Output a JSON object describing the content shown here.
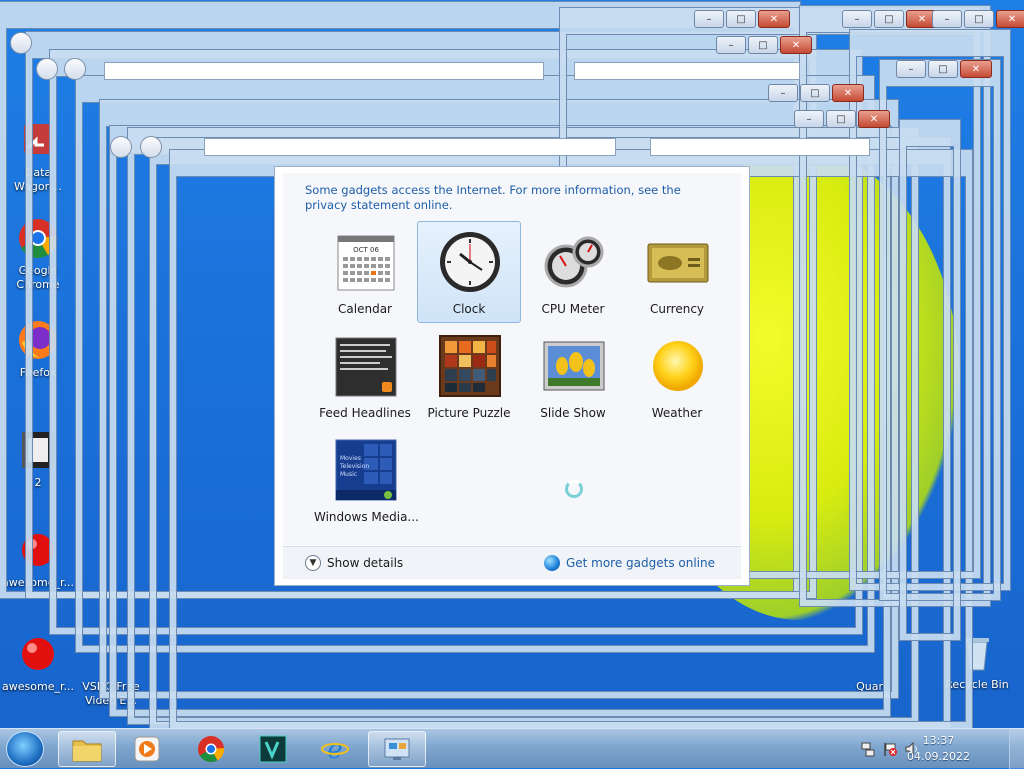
{
  "gallery": {
    "privacy_notice": "Some gadgets access the Internet.  For more information, see the privacy statement online.",
    "gadgets": [
      {
        "label": "Calendar",
        "icon": "calendar-icon",
        "month": "OCT 06"
      },
      {
        "label": "Clock",
        "icon": "clock-icon",
        "selected": true
      },
      {
        "label": "CPU Meter",
        "icon": "cpu-meter-icon"
      },
      {
        "label": "Currency",
        "icon": "currency-icon"
      },
      {
        "label": "Feed Headlines",
        "icon": "feed-headlines-icon"
      },
      {
        "label": "Picture Puzzle",
        "icon": "picture-puzzle-icon"
      },
      {
        "label": "Slide Show",
        "icon": "slide-show-icon"
      },
      {
        "label": "Weather",
        "icon": "weather-icon"
      },
      {
        "label": "Windows Media...",
        "icon": "windows-media-center-icon",
        "thumb_lines": [
          "Movies",
          "Television",
          "Music"
        ]
      }
    ],
    "show_details": "Show details",
    "get_more": "Get more gadgets online"
  },
  "desktop_icons": [
    {
      "label": "Data Wagon...",
      "icon": "shortcut-icon"
    },
    {
      "label": "Google Chrome",
      "icon": "chrome-icon"
    },
    {
      "label": "Firefox",
      "icon": "firefox-icon"
    },
    {
      "label": "2",
      "icon": "video-file-icon"
    },
    {
      "label": "awesome_r...",
      "icon": "red-ball-icon"
    },
    {
      "label": "awesome_r...",
      "icon": "red-ball-icon"
    },
    {
      "label": "VSDC Free Video E...",
      "icon": "vsdc-icon"
    },
    {
      "label": "Quan...",
      "icon": "app-icon"
    },
    {
      "label": "Recycle Bin",
      "icon": "recycle-bin-icon"
    }
  ],
  "taskbar": {
    "items": [
      {
        "name": "explorer",
        "icon": "folder-icon"
      },
      {
        "name": "media-player",
        "icon": "media-player-icon"
      },
      {
        "name": "chrome",
        "icon": "chrome-icon"
      },
      {
        "name": "media-app",
        "icon": "media-app-icon"
      },
      {
        "name": "internet-explorer",
        "icon": "ie-icon"
      },
      {
        "name": "gadget-gallery",
        "icon": "gadget-gallery-icon"
      }
    ],
    "time": "13:37",
    "date": "04.09.2022"
  }
}
